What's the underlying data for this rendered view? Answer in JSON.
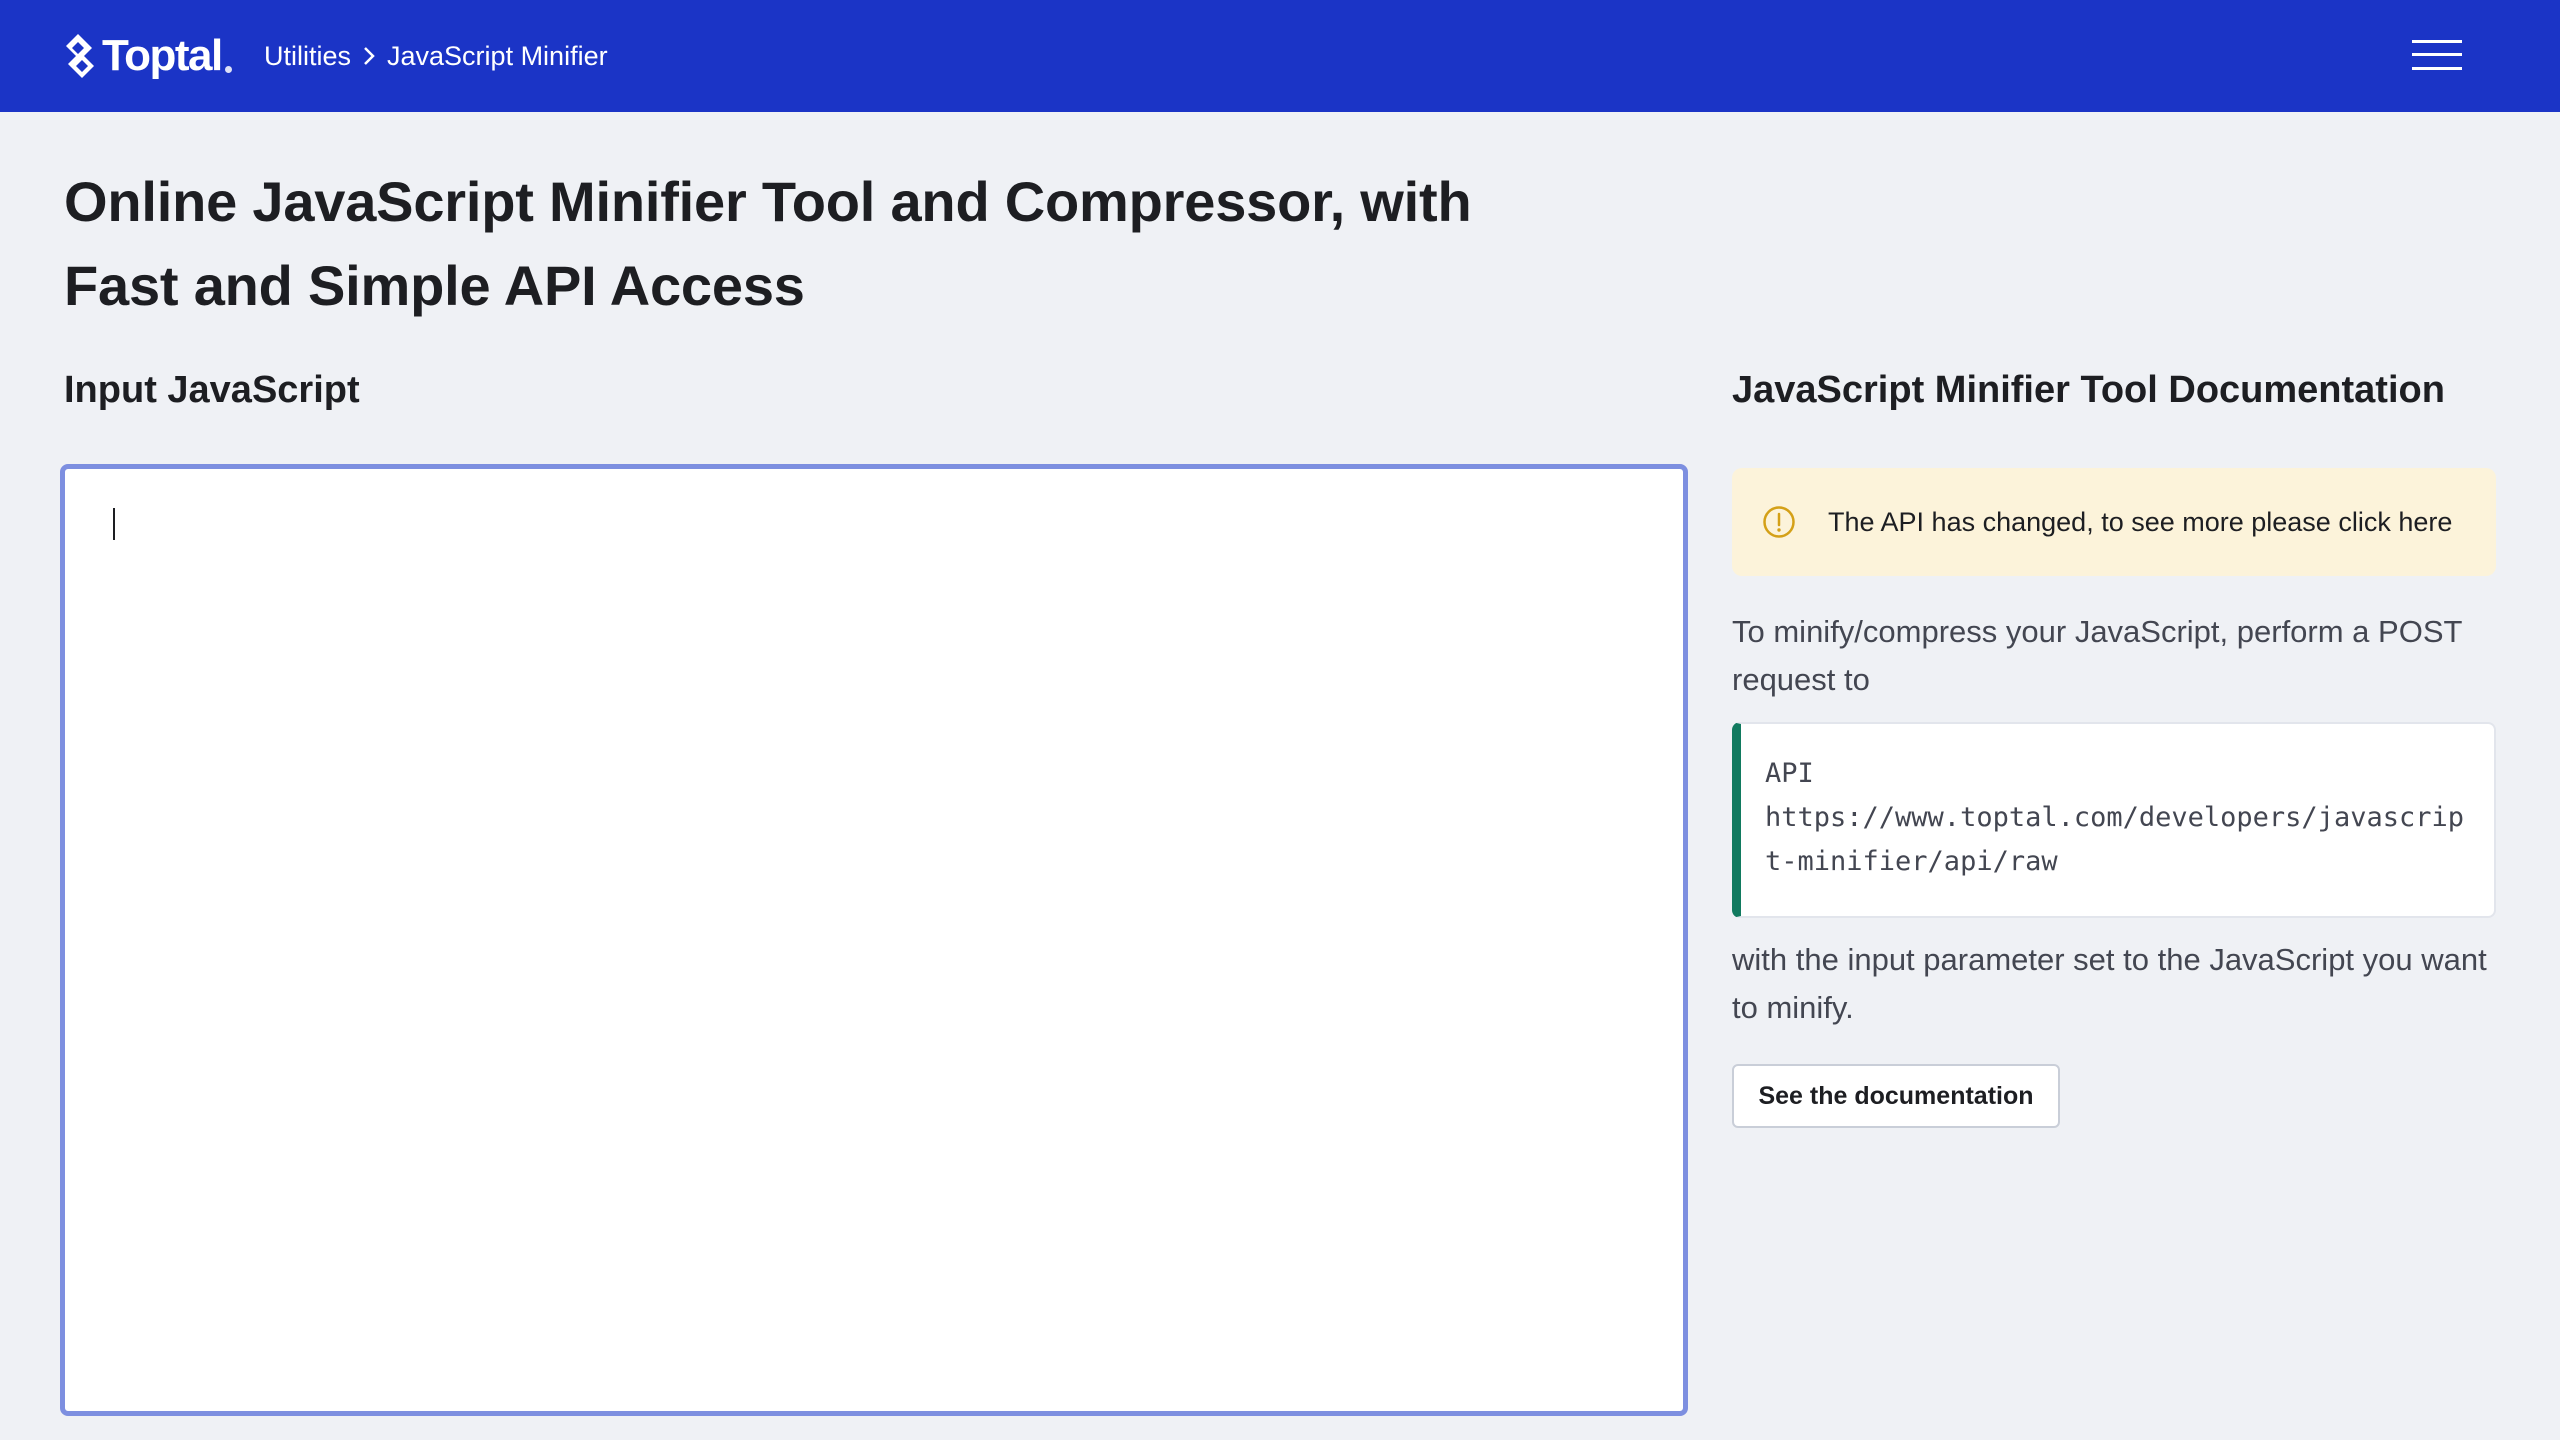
{
  "header": {
    "logo_text": "Toptal",
    "breadcrumb": {
      "parent": "Utilities",
      "current": "JavaScript Minifier"
    },
    "menu_icon": "hamburger-menu-icon"
  },
  "page": {
    "title": "Online JavaScript Minifier Tool and Compressor, with Fast and Simple API Access"
  },
  "input_section": {
    "heading": "Input JavaScript",
    "editor_value": ""
  },
  "docs_section": {
    "heading": "JavaScript Minifier Tool Documentation",
    "notice": {
      "icon": "warning-circle-icon",
      "text": "The API has changed, to see more please click here"
    },
    "intro_text": "To minify/compress your JavaScript, perform a POST request to",
    "api": {
      "label": "API",
      "url": "https://www.toptal.com/developers/javascript-minifier/api/raw"
    },
    "param_text": "with the input parameter set to the JavaScript you want to minify.",
    "button_label": "See the documentation"
  },
  "colors": {
    "header_bg": "#1b34c6",
    "page_bg": "#eff1f5",
    "editor_border": "#7d8fe0",
    "notice_bg": "#fcf3da",
    "notice_icon": "#d4a017",
    "api_accent": "#117a5f"
  }
}
